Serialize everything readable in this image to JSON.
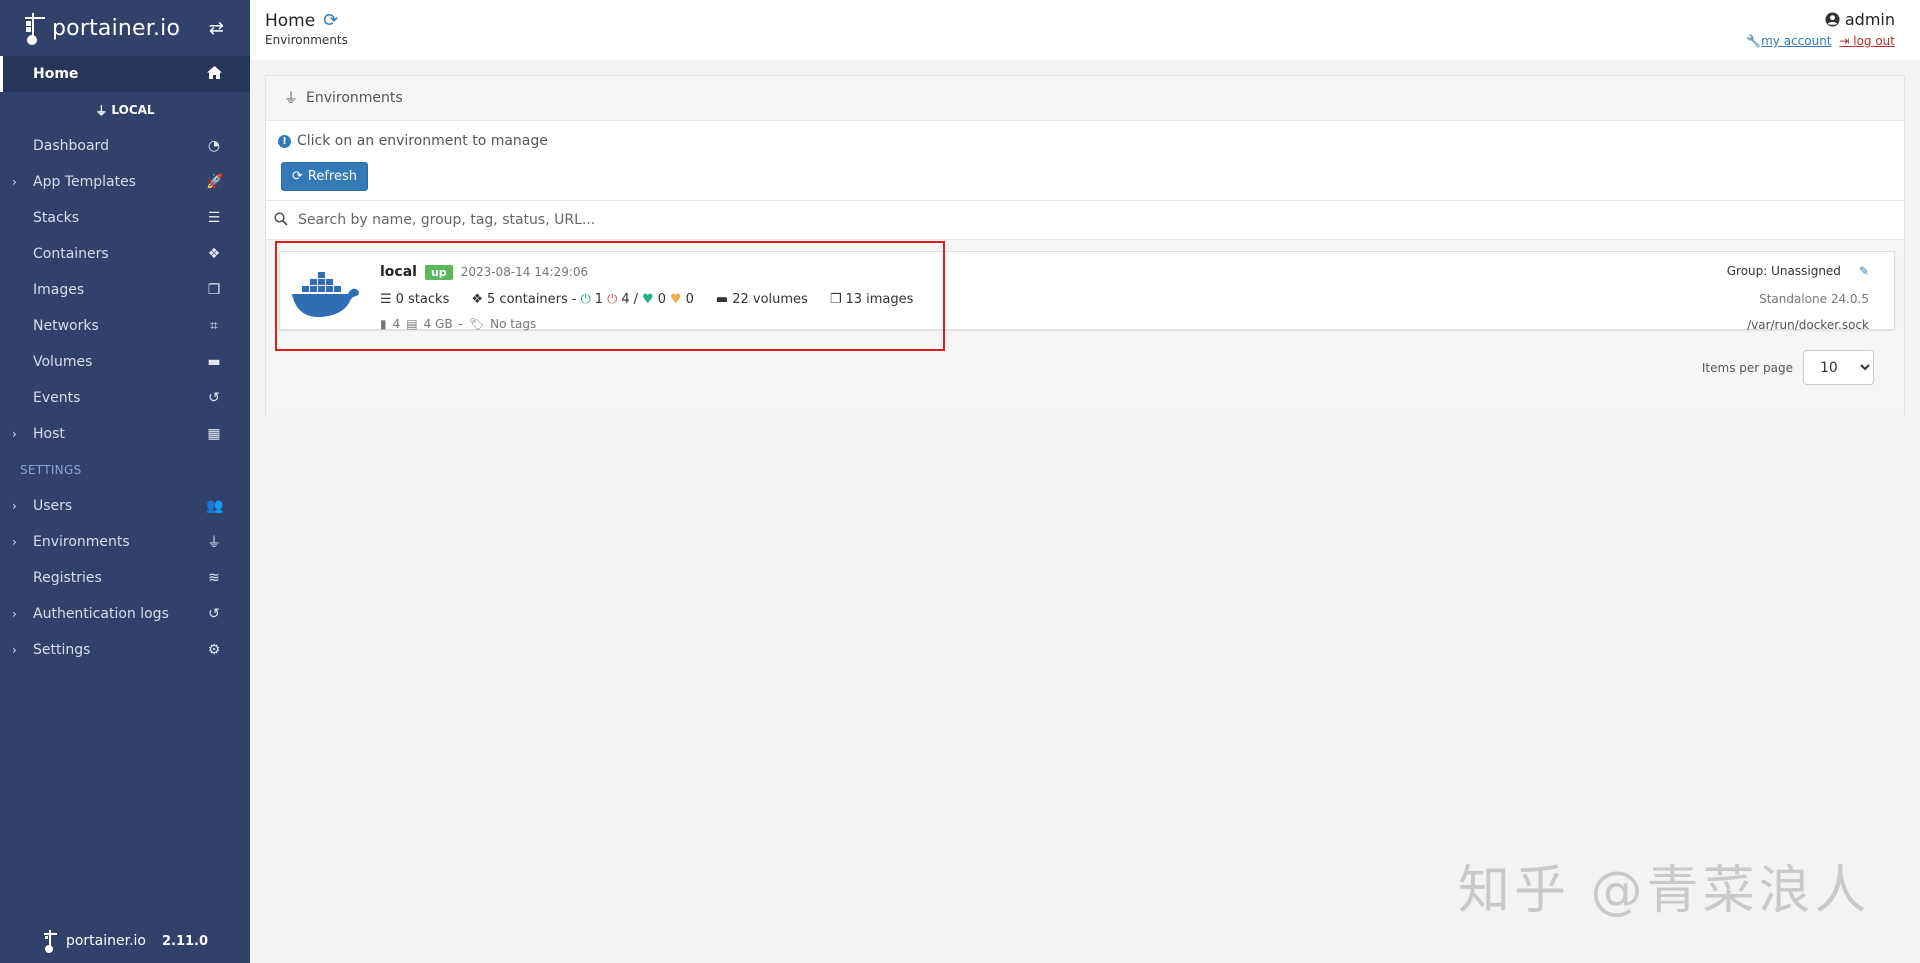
{
  "sidebar": {
    "brand": "portainer.io",
    "home": "Home",
    "environment_label": "LOCAL",
    "env_items": [
      {
        "label": "Dashboard",
        "icon": "tachometer-icon",
        "expandable": false
      },
      {
        "label": "App Templates",
        "icon": "rocket-icon",
        "expandable": true
      },
      {
        "label": "Stacks",
        "icon": "th-list-icon",
        "expandable": false
      },
      {
        "label": "Containers",
        "icon": "cubes-icon",
        "expandable": false
      },
      {
        "label": "Images",
        "icon": "clone-icon",
        "expandable": false
      },
      {
        "label": "Networks",
        "icon": "sitemap-icon",
        "expandable": false
      },
      {
        "label": "Volumes",
        "icon": "hdd-icon",
        "expandable": false
      },
      {
        "label": "Events",
        "icon": "history-icon",
        "expandable": false
      },
      {
        "label": "Host",
        "icon": "th-icon",
        "expandable": true
      }
    ],
    "settings_section": "SETTINGS",
    "settings_items": [
      {
        "label": "Users",
        "icon": "users-icon",
        "expandable": true
      },
      {
        "label": "Environments",
        "icon": "plug-icon",
        "expandable": true
      },
      {
        "label": "Registries",
        "icon": "database-icon",
        "expandable": false
      },
      {
        "label": "Authentication logs",
        "icon": "history-icon",
        "expandable": true
      },
      {
        "label": "Settings",
        "icon": "cogs-icon",
        "expandable": true
      }
    ],
    "footer_brand": "portainer.io",
    "footer_version": "2.11.0"
  },
  "header": {
    "title": "Home",
    "breadcrumb": "Environments",
    "username": "admin",
    "my_account": "my account",
    "log_out": "log out"
  },
  "widget": {
    "title": "Environments",
    "info": "Click on an environment to manage",
    "refresh_label": "Refresh",
    "search_placeholder": "Search by name, group, tag, status, URL...",
    "environment": {
      "name": "local",
      "status": "up",
      "timestamp": "2023-08-14 14:29:06",
      "stacks": "0 stacks",
      "containers": "5 containers",
      "running": "1",
      "stopped": "4",
      "healthy": "0",
      "unhealthy": "0",
      "volumes": "22 volumes",
      "images": "13 images",
      "cpu": "4",
      "memory": "4 GB",
      "tags": "No tags",
      "group": "Group: Unassigned",
      "engine": "Standalone 24.0.5",
      "url": "/var/run/docker.sock"
    },
    "items_per_page_label": "Items per page",
    "items_per_page": "10"
  },
  "colors": {
    "sidebar_bg": "#30426a",
    "primary": "#337ab7",
    "status_up": "#5cb85c",
    "highlight": "#e01c1c"
  },
  "watermark": "知乎 @青菜浪人"
}
